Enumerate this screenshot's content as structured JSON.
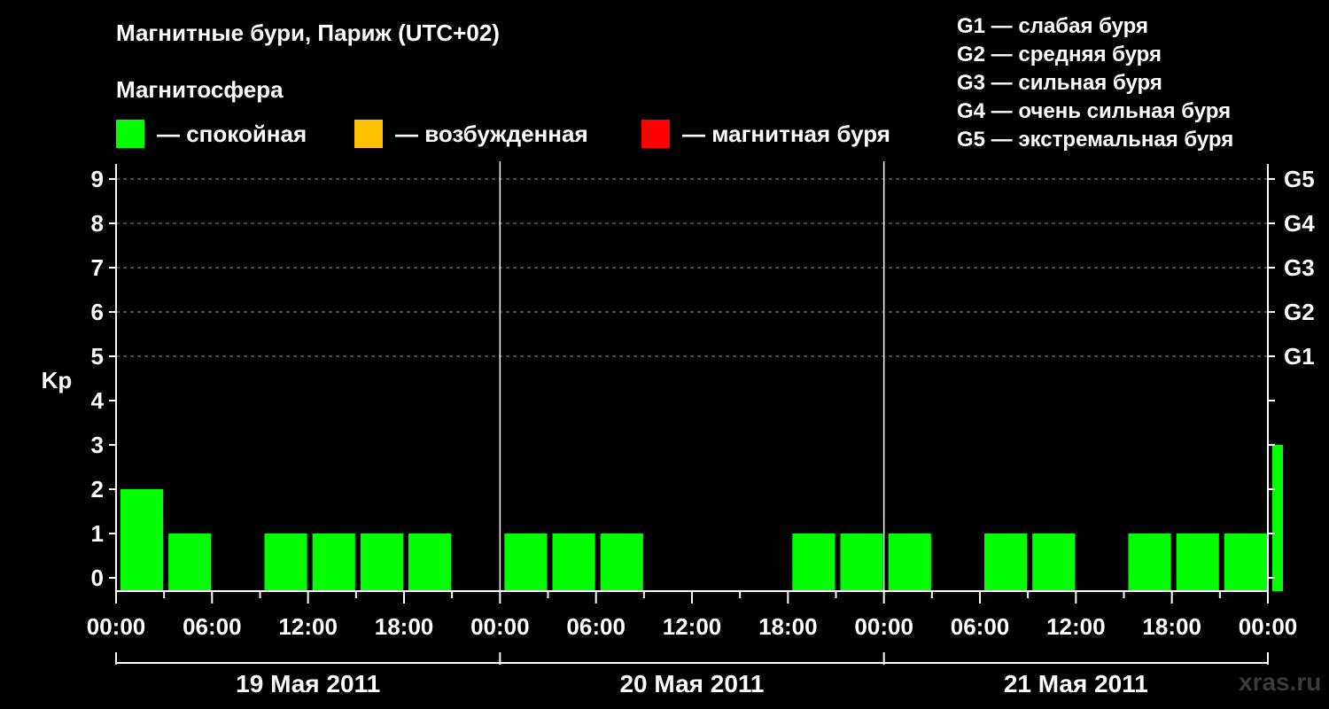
{
  "header": {
    "title": "Магнитные бури, Париж (UTC+02)",
    "subtitle": "Магнитосфера"
  },
  "legend": [
    {
      "label": "— спокойная",
      "color": "#00ff00"
    },
    {
      "label": "— возбужденная",
      "color": "#ffc000"
    },
    {
      "label": "— магнитная буря",
      "color": "#ff0000"
    }
  ],
  "g_legend": [
    "G1 — слабая буря",
    "G2 — средняя буря",
    "G3 — сильная буря",
    "G4 — очень сильная буря",
    "G5 — экстремальная буря"
  ],
  "watermark": "xras.ru",
  "chart_data": {
    "type": "bar",
    "ylabel": "Kp",
    "ylim": [
      0,
      9
    ],
    "y_ticks": [
      0,
      1,
      2,
      3,
      4,
      5,
      6,
      7,
      8,
      9
    ],
    "right_axis_labels": [
      {
        "y": 5,
        "label": "G1"
      },
      {
        "y": 6,
        "label": "G2"
      },
      {
        "y": 7,
        "label": "G3"
      },
      {
        "y": 8,
        "label": "G4"
      },
      {
        "y": 9,
        "label": "G5"
      }
    ],
    "x_tick_labels": [
      "00:00",
      "06:00",
      "12:00",
      "18:00",
      "00:00",
      "06:00",
      "12:00",
      "18:00",
      "00:00",
      "06:00",
      "12:00",
      "18:00",
      "00:00"
    ],
    "days": [
      "19 Мая 2011",
      "20 Мая 2011",
      "21 Мая 2011"
    ],
    "grid": "dashed at Kp 5–9",
    "bar_color": "#00ff00",
    "values": [
      2,
      1,
      0,
      1,
      1,
      1,
      1,
      0,
      1,
      1,
      1,
      0,
      0,
      0,
      1,
      1,
      1,
      0,
      1,
      1,
      0,
      1,
      1,
      1,
      3
    ]
  }
}
